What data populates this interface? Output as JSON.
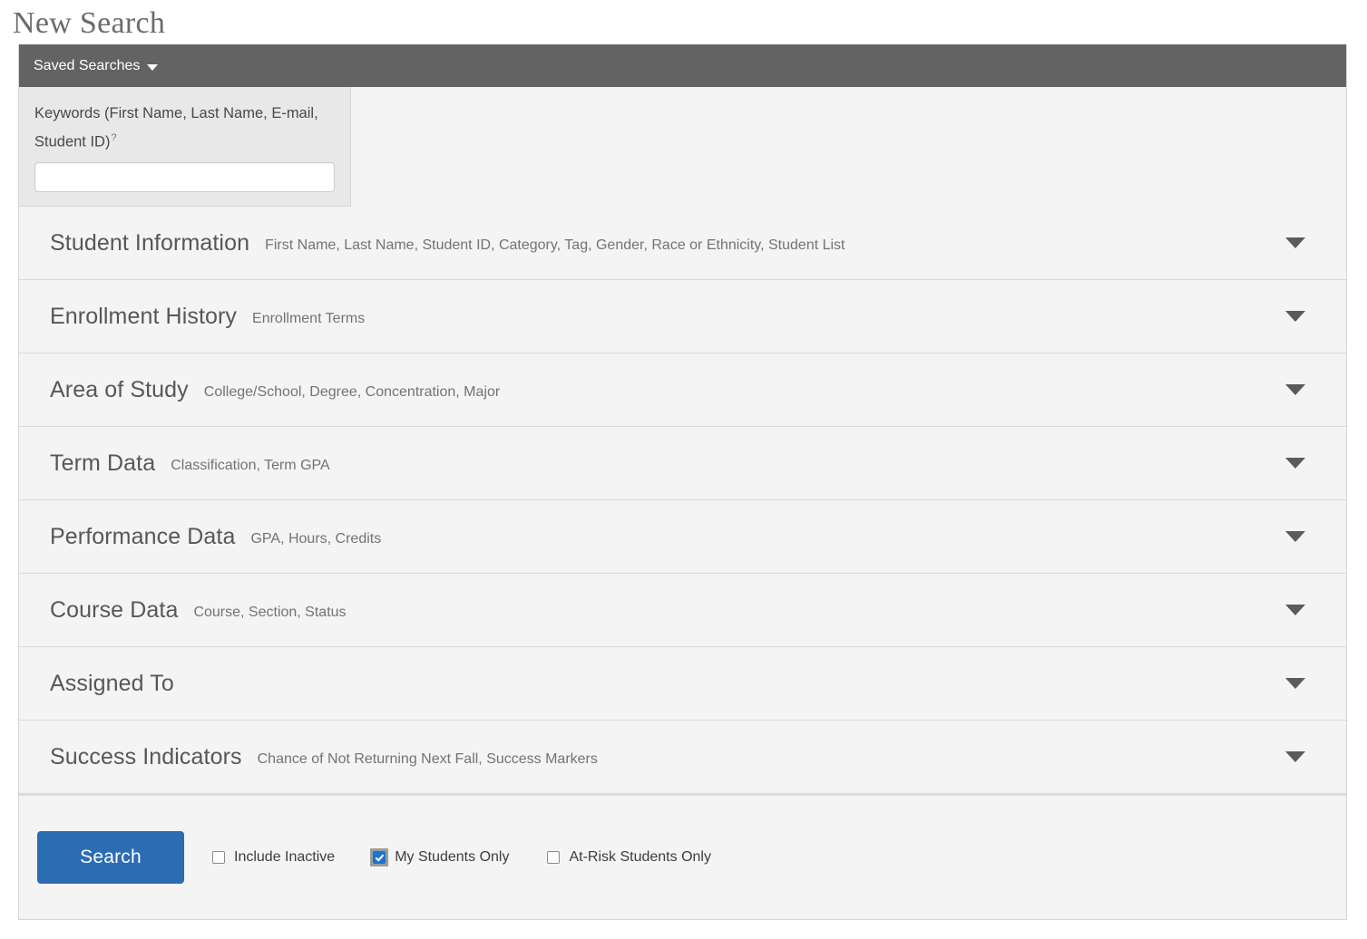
{
  "page_title": "New Search",
  "saved_searches": {
    "label": "Saved Searches",
    "caret_icon": "chevron-down-icon"
  },
  "keywords": {
    "label": "Keywords (First Name, Last Name, E-mail, Student ID)",
    "help_marker": "?",
    "value": "",
    "placeholder": ""
  },
  "sections": [
    {
      "title": "Student Information",
      "subtitle": "First Name, Last Name, Student ID, Category, Tag, Gender, Race or Ethnicity, Student List",
      "toggle_icon": "triangle-down-icon",
      "expanded": false
    },
    {
      "title": "Enrollment History",
      "subtitle": "Enrollment Terms",
      "toggle_icon": "triangle-down-icon",
      "expanded": false
    },
    {
      "title": "Area of Study",
      "subtitle": "College/School, Degree, Concentration, Major",
      "toggle_icon": "triangle-down-icon",
      "expanded": false
    },
    {
      "title": "Term Data",
      "subtitle": "Classification, Term GPA",
      "toggle_icon": "triangle-down-icon",
      "expanded": false
    },
    {
      "title": "Performance Data",
      "subtitle": "GPA, Hours, Credits",
      "toggle_icon": "triangle-down-icon",
      "expanded": false
    },
    {
      "title": "Course Data",
      "subtitle": "Course, Section, Status",
      "toggle_icon": "triangle-down-icon",
      "expanded": false
    },
    {
      "title": "Assigned To",
      "subtitle": "",
      "toggle_icon": "triangle-down-icon",
      "expanded": false
    },
    {
      "title": "Success Indicators",
      "subtitle": "Chance of Not Returning Next Fall, Success Markers",
      "toggle_icon": "triangle-down-icon",
      "expanded": false
    }
  ],
  "footer": {
    "search_button_label": "Search",
    "checkboxes": [
      {
        "label": "Include Inactive",
        "checked": false
      },
      {
        "label": "My Students Only",
        "checked": true
      },
      {
        "label": "At-Risk Students Only",
        "checked": false
      }
    ]
  },
  "colors": {
    "bar_background": "#636363",
    "panel_background": "#f4f4f4",
    "keyword_panel_background": "#e8e8e8",
    "primary_button": "#2b6cb2",
    "checkbox_checked": "#1a73d4",
    "title_text": "#6b6b6b",
    "section_title_text": "#575757",
    "section_subtitle_text": "#6f7478"
  }
}
